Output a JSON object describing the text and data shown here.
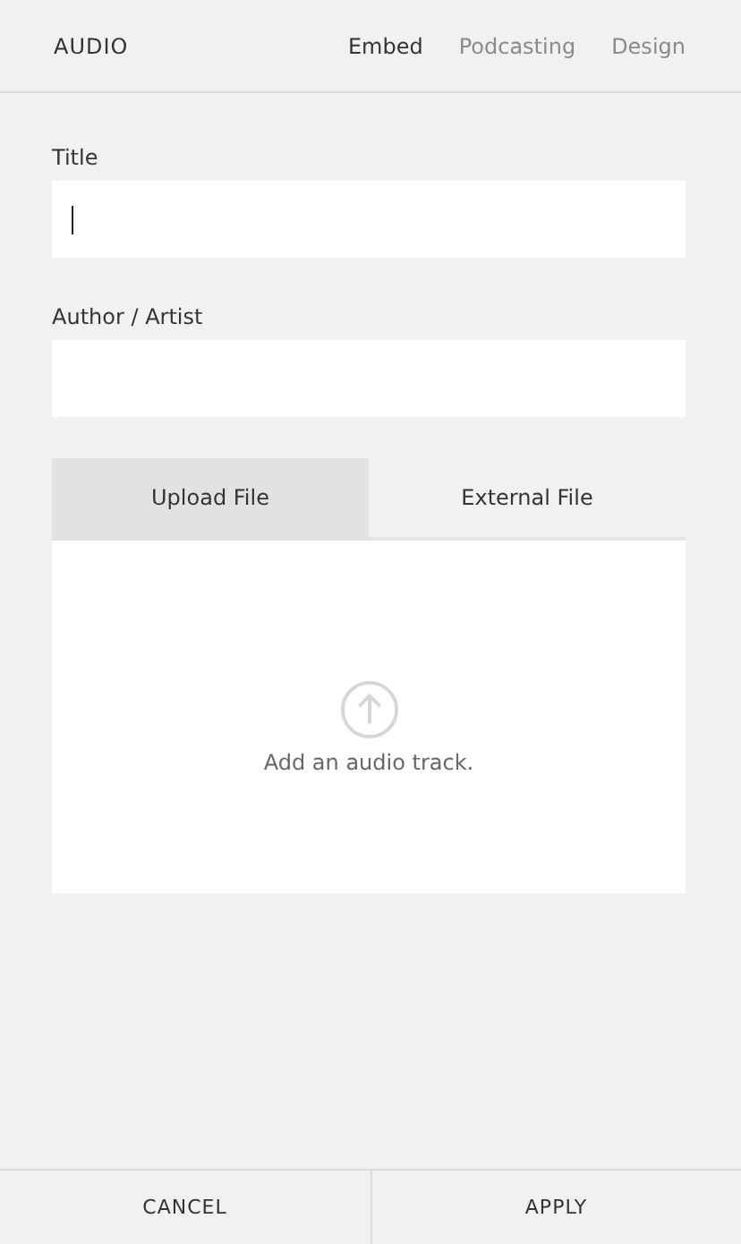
{
  "header": {
    "title": "AUDIO",
    "tabs": [
      {
        "label": "Embed",
        "selected": true
      },
      {
        "label": "Podcasting",
        "selected": false
      },
      {
        "label": "Design",
        "selected": false
      }
    ]
  },
  "fields": [
    {
      "label": "Title",
      "focused": true
    },
    {
      "label": "Author / Artist",
      "focused": false
    }
  ],
  "source_tabs": [
    {
      "label": "Upload File",
      "selected": true
    },
    {
      "label": "External File",
      "selected": false
    }
  ],
  "upload": {
    "message": "Add an audio track."
  },
  "buttons": [
    "CANCEL",
    "APPLY"
  ]
}
